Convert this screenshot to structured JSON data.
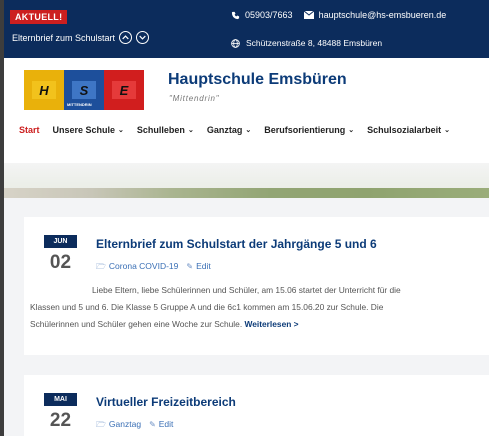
{
  "topbar": {
    "badge": "AKTUELL!",
    "ticker": "Elternbrief zum Schulstart",
    "phone": "05903/7663",
    "email": "hauptschule@hs-emsbueren.de",
    "address": "Schützenstraße 8, 48488 Emsbüren"
  },
  "logo": {
    "letters": [
      "H",
      "S",
      "E"
    ],
    "tile_caption": "MITTENDRIN"
  },
  "header": {
    "school_name": "Hauptschule Emsbüren",
    "motto": "\"Mittendrin\""
  },
  "nav": {
    "items": [
      {
        "label": "Start"
      },
      {
        "label": "Unsere Schule"
      },
      {
        "label": "Schulleben"
      },
      {
        "label": "Ganztag"
      },
      {
        "label": "Berufsorientierung"
      },
      {
        "label": "Schulsozialarbeit"
      }
    ]
  },
  "posts": [
    {
      "month": "JUN",
      "day": "02",
      "title": "Elternbrief zum Schulstart der Jahrgänge 5 und 6",
      "category": "Corona COVID-19",
      "edit": "Edit",
      "excerpt_line1": "Liebe Eltern, liebe Schülerinnen und Schüler, am 15.06 startet der Unterricht für die",
      "excerpt_line2": "Klassen und 5 und 6. Die Klasse 5 Gruppe A und die 6c1 kommen am 15.06.20 zur Schule. Die",
      "excerpt_line3": "Schülerinnen und Schüler gehen eine Woche zur Schule.",
      "read_more": "Weiterlesen >"
    },
    {
      "month": "MAI",
      "day": "22",
      "title": "Virtueller Freizeitbereich",
      "category": "Ganztag",
      "edit": "Edit"
    }
  ],
  "colors": {
    "topbar": "#0c2c5c",
    "accent_red": "#cc1f1f",
    "title_blue": "#0c3b78"
  }
}
